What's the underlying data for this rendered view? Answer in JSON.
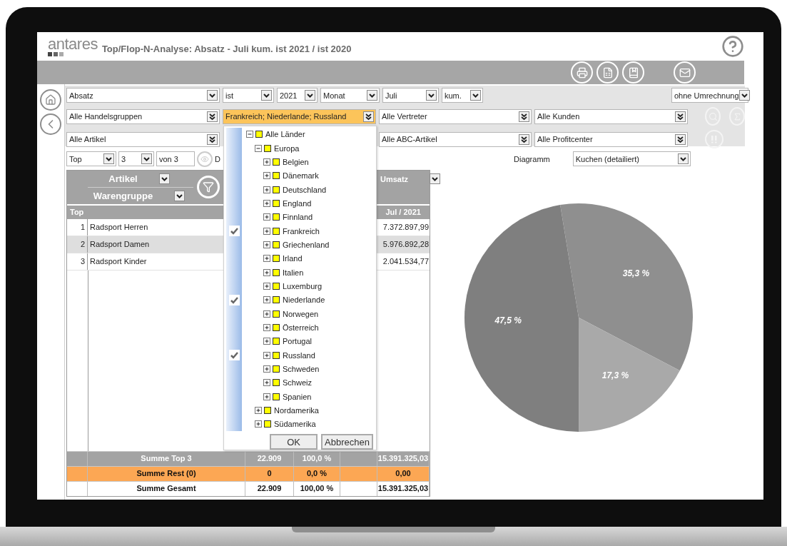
{
  "header": {
    "logo": "antares",
    "title": "Top/Flop-N-Analyse: Absatz - Juli kum. ist 2021 / ist 2020"
  },
  "filters": [
    [
      {
        "value": "Absatz",
        "kind": "single",
        "open": false
      },
      {
        "value": "ist",
        "kind": "single",
        "open": false
      },
      {
        "value": "2021",
        "kind": "single",
        "open": false
      },
      {
        "value": "Monat",
        "kind": "single",
        "open": false
      },
      {
        "value": "Juli",
        "kind": "single",
        "open": false
      },
      {
        "value": "kum.",
        "kind": "single",
        "open": false
      },
      {
        "value": "ohne Umrechnung",
        "kind": "single",
        "open": false
      }
    ],
    [
      {
        "value": "Alle Handelsgruppen",
        "kind": "multi",
        "open": false
      },
      {
        "value": "Frankreich; Niederlande; Russland",
        "kind": "multi",
        "open": true
      },
      {
        "value": "Alle Vertreter",
        "kind": "multi",
        "open": false
      },
      {
        "value": "Alle Kunden",
        "kind": "multi",
        "open": false
      }
    ],
    [
      {
        "value": "Alle Artikel",
        "kind": "multi",
        "open": false
      },
      {
        "value": "Alle ABC-Artikel",
        "kind": "multi",
        "open": false
      },
      {
        "value": "Alle Profitcenter",
        "kind": "multi",
        "open": false
      }
    ]
  ],
  "controls": {
    "mode": "Top",
    "count": "3",
    "of": "von 3",
    "cut_label": "D",
    "chart_label": "Diagramm",
    "chart_type": "Kuchen (detailiert)"
  },
  "table": {
    "dims": [
      "Artikel",
      "Warengruppe"
    ],
    "measure": "Umsatz",
    "rank_header": "Top",
    "period": "Jul / 2021",
    "rows": [
      {
        "rank": "1",
        "name": "Radsport Herren",
        "value": "7.372.897,99",
        "selected": false
      },
      {
        "rank": "2",
        "name": "Radsport Damen",
        "value": "5.976.892,28",
        "selected": true
      },
      {
        "rank": "3",
        "name": "Radsport Kinder",
        "value": "2.041.534,77",
        "selected": false
      }
    ],
    "sums": [
      {
        "kind": "top",
        "label": "Summe Top 3",
        "qty": "22.909",
        "share": "100,0 %",
        "value": "15.391.325,03"
      },
      {
        "kind": "rest",
        "label": "Summe Rest (0)",
        "qty": "0",
        "share": "0,0 %",
        "value": "0,00"
      },
      {
        "kind": "total",
        "label": "Summe Gesamt",
        "qty": "22.909",
        "share": "100,00 %",
        "value": "15.391.325,03"
      }
    ]
  },
  "dropdown": {
    "tree": [
      {
        "label": "Alle Länder",
        "expanded": true,
        "checked": false,
        "children": [
          {
            "label": "Europa",
            "expanded": true,
            "checked": false,
            "children": [
              {
                "label": "Belgien",
                "expanded": false,
                "checked": false
              },
              {
                "label": "Dänemark",
                "expanded": false,
                "checked": false
              },
              {
                "label": "Deutschland",
                "expanded": false,
                "checked": false
              },
              {
                "label": "England",
                "expanded": false,
                "checked": false
              },
              {
                "label": "Finnland",
                "expanded": false,
                "checked": false
              },
              {
                "label": "Frankreich",
                "expanded": false,
                "checked": true
              },
              {
                "label": "Griechenland",
                "expanded": false,
                "checked": false
              },
              {
                "label": "Irland",
                "expanded": false,
                "checked": false
              },
              {
                "label": "Italien",
                "expanded": false,
                "checked": false
              },
              {
                "label": "Luxemburg",
                "expanded": false,
                "checked": false
              },
              {
                "label": "Niederlande",
                "expanded": false,
                "checked": true
              },
              {
                "label": "Norwegen",
                "expanded": false,
                "checked": false
              },
              {
                "label": "Österreich",
                "expanded": false,
                "checked": false
              },
              {
                "label": "Portugal",
                "expanded": false,
                "checked": false
              },
              {
                "label": "Russland",
                "expanded": false,
                "checked": true
              },
              {
                "label": "Schweden",
                "expanded": false,
                "checked": false
              },
              {
                "label": "Schweiz",
                "expanded": false,
                "checked": false
              },
              {
                "label": "Spanien",
                "expanded": false,
                "checked": false
              }
            ]
          },
          {
            "label": "Nordamerika",
            "expanded": false,
            "checked": false
          },
          {
            "label": "Südamerika",
            "expanded": false,
            "checked": false
          }
        ]
      }
    ],
    "buttons": [
      "OK",
      "Abbrechen"
    ]
  },
  "chart_data": {
    "type": "pie",
    "values": [
      35.3,
      17.3,
      47.5
    ],
    "data_labels": true,
    "value_labels": [
      "35,3 %",
      "17,3 %",
      "47,5 %"
    ]
  }
}
